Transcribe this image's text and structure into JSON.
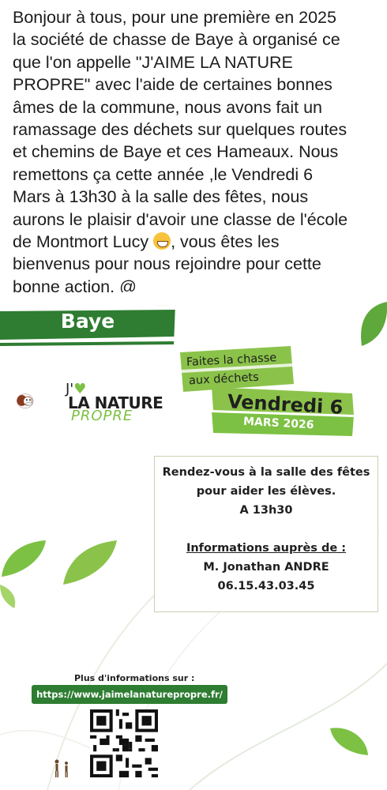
{
  "post": {
    "lines": [
      "Bonjour à tous, pour une première en 2025",
      "la société de chasse de Baye à organisé ce",
      "que l'on appelle \"J'AIME LA NATURE",
      "PROPRE\" avec l'aide de certaines bonnes",
      "âmes de la commune, nous avons fait un",
      "ramassage des déchets sur quelques routes",
      "et chemins de Baye et ces Hameaux. Nous",
      "remettons ça cette année ,le Vendredi 6",
      "Mars à 13h30 à la salle des fêtes, nous",
      "aurons le plaisir d'avoir une classe de l'école",
      "de Montmort Lucy",
      ",  vous êtes les",
      "bienvenus pour nous rejoindre pour cette",
      "bonne action. @"
    ]
  },
  "poster": {
    "village": "Baye",
    "chasse_line1": "Faites la chasse",
    "chasse_line2": "aux déchets",
    "day": "Vendredi 6",
    "month_year": "MARS 2026",
    "logo": {
      "jai": "J'",
      "la_nature": "LA NATURE",
      "propre": "PROPRE"
    },
    "info": {
      "line1": "Rendez-vous à la salle des fêtes",
      "line2": "pour aider les élèves.",
      "line3": "A 13h30",
      "contact_title": "Informations auprès de :",
      "contact_name": "M. Jonathan ANDRE",
      "contact_phone": "06.15.43.03.45"
    },
    "more_info_label": "Plus d'informations sur :",
    "url": "https://www.jaimelanaturepropre.fr/",
    "colors": {
      "dark_green": "#2e7d32",
      "light_green": "#8bc34a",
      "leaf": "#7cc143"
    }
  }
}
